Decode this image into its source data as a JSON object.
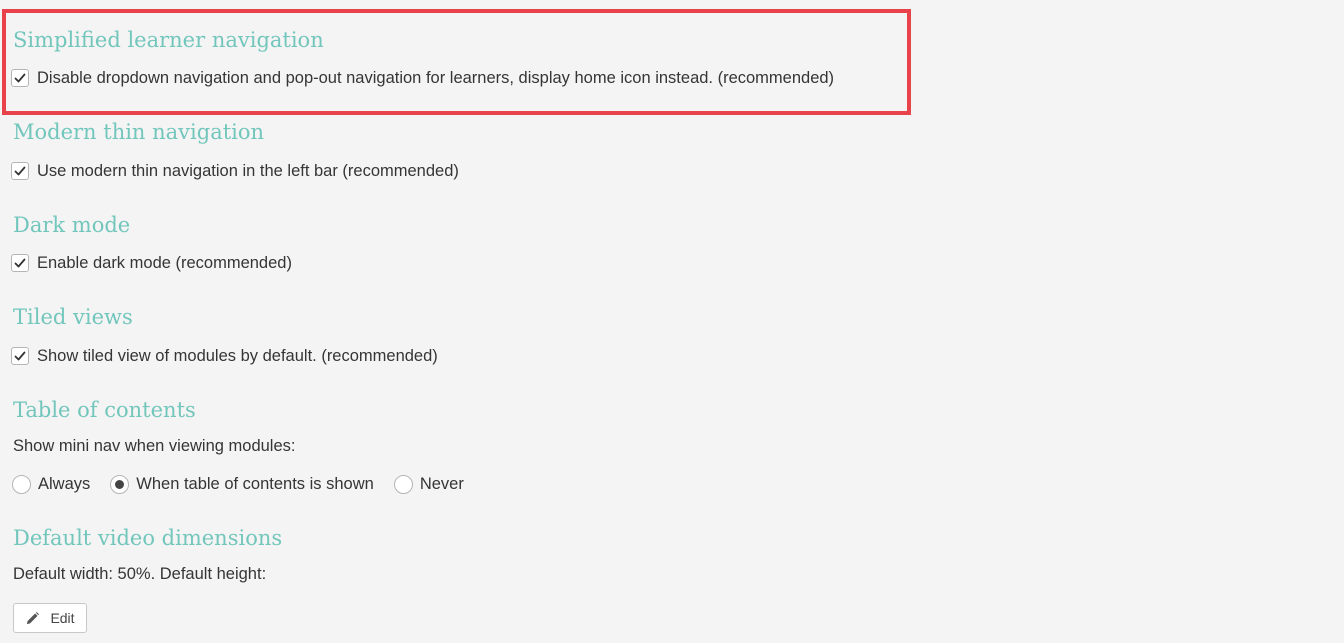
{
  "sections": {
    "simplified": {
      "title": "Simplified learner navigation",
      "checkbox_label": "Disable dropdown navigation and pop-out navigation for learners, display home icon instead. (recommended)",
      "checked": true
    },
    "modern_thin": {
      "title": "Modern thin navigation",
      "checkbox_label": "Use modern thin navigation in the left bar (recommended)",
      "checked": true
    },
    "dark_mode": {
      "title": "Dark mode",
      "checkbox_label": "Enable dark mode (recommended)",
      "checked": true
    },
    "tiled_views": {
      "title": "Tiled views",
      "checkbox_label": "Show tiled view of modules by default. (recommended)",
      "checked": true
    },
    "toc": {
      "title": "Table of contents",
      "description": "Show mini nav when viewing modules:",
      "options": [
        {
          "label": "Always",
          "selected": false
        },
        {
          "label": "When table of contents is shown",
          "selected": true
        },
        {
          "label": "Never",
          "selected": false
        }
      ]
    },
    "video": {
      "title": "Default video dimensions",
      "description": "Default width: 50%. Default height:",
      "edit_label": "Edit"
    }
  },
  "colors": {
    "heading": "#72c6bc",
    "highlight_border": "#e8424a",
    "background": "#f4f4f4"
  },
  "icons": {
    "checkbox": "check-icon",
    "edit": "pencil-icon"
  }
}
